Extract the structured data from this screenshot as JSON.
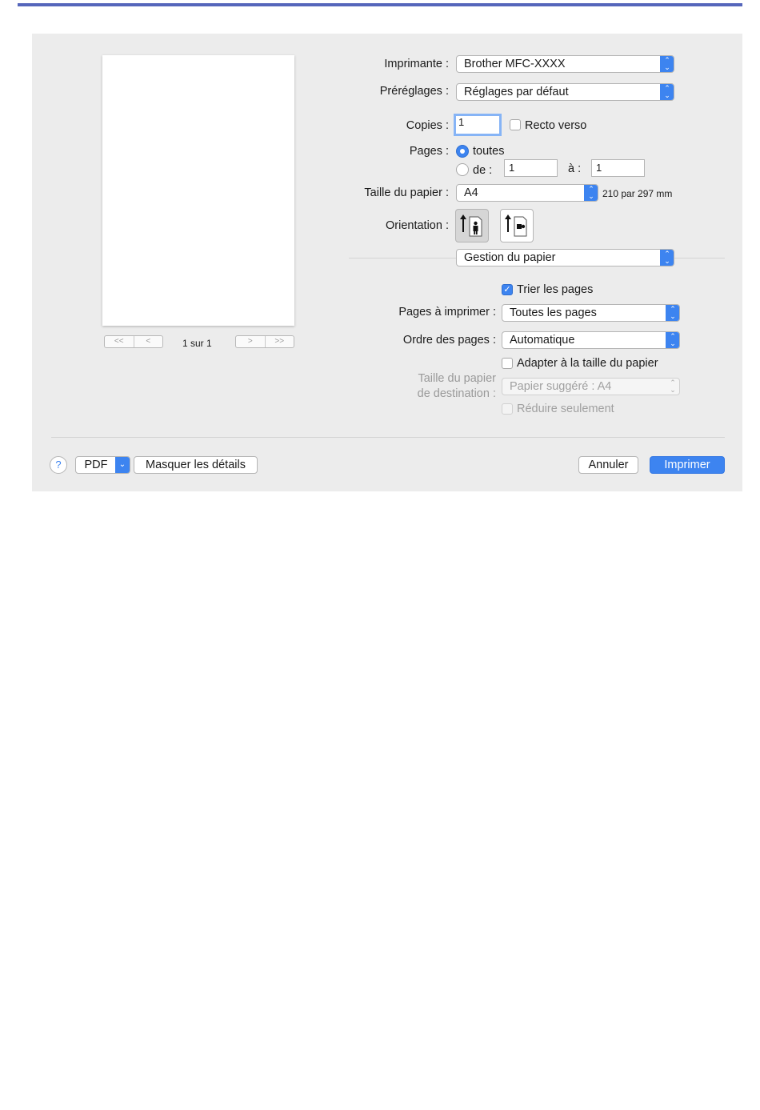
{
  "colors": {
    "accent": "#3d84f0",
    "top_rule": "#5566bb",
    "dialog_bg": "#ececec"
  },
  "preview": {
    "page_count": "1 sur 1",
    "nav_first": "<<",
    "nav_prev": "<",
    "nav_next": ">",
    "nav_last": ">>"
  },
  "printer": {
    "label": "Imprimante :",
    "value": "Brother MFC-XXXX"
  },
  "presets": {
    "label": "Préréglages :",
    "value": "Réglages par défaut"
  },
  "copies": {
    "label": "Copies :",
    "value": "1",
    "duplex_label": "Recto verso",
    "duplex_checked": false
  },
  "pages": {
    "label": "Pages :",
    "all_label": "toutes",
    "all_selected": true,
    "from_label": "de :",
    "from_value": "1",
    "to_label": "à :",
    "to_value": "1"
  },
  "paper_size": {
    "label": "Taille du papier :",
    "value": "A4",
    "dimensions": "210 par 297 mm"
  },
  "orientation": {
    "label": "Orientation :",
    "portrait_icon": "portrait-orientation-icon",
    "landscape_icon": "landscape-orientation-icon",
    "selected": "portrait"
  },
  "section": {
    "value": "Gestion du papier"
  },
  "paper_handling": {
    "collate_label": "Trier les pages",
    "collate_checked": true,
    "pages_to_print_label": "Pages à imprimer :",
    "pages_to_print_value": "Toutes les pages",
    "page_order_label": "Ordre des pages :",
    "page_order_value": "Automatique",
    "scale_to_fit_label": "Adapter à la taille du papier",
    "scale_to_fit_checked": false,
    "dest_size_label_1": "Taille du papier",
    "dest_size_label_2": "de destination :",
    "dest_size_value": "Papier suggéré : A4",
    "scale_down_label": "Réduire seulement",
    "scale_down_checked": false
  },
  "footer": {
    "help": "?",
    "pdf": "PDF",
    "hide_details": "Masquer les détails",
    "cancel": "Annuler",
    "print": "Imprimer"
  }
}
